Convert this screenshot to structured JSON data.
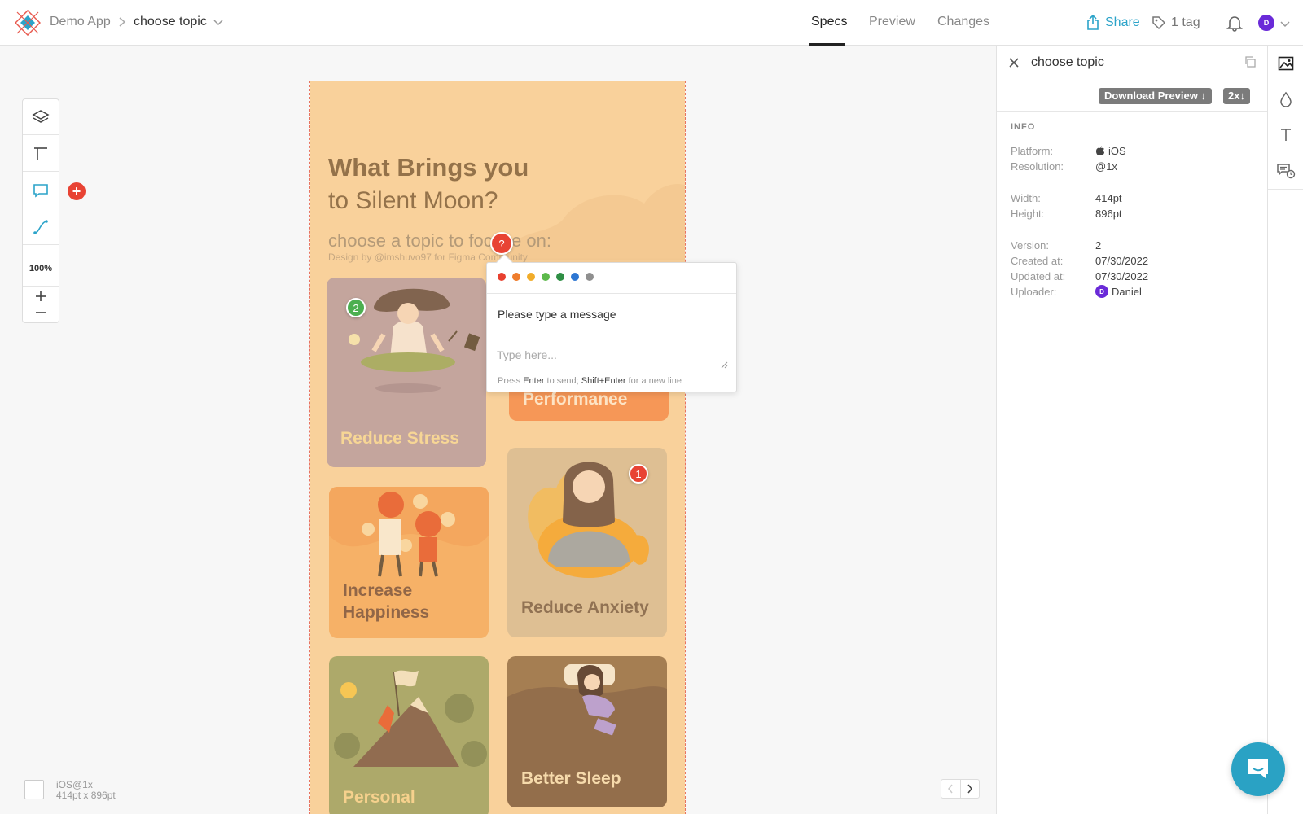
{
  "header": {
    "project": "Demo App",
    "screen": "choose topic",
    "tabs": [
      "Specs",
      "Preview",
      "Changes"
    ],
    "active_tab": "Specs",
    "share_label": "Share",
    "tag_label": "1 tag",
    "avatar_initial": "D"
  },
  "toolbar": {
    "zoom": "100%"
  },
  "artboard": {
    "title_line1": "What Brings you",
    "title_line2": "to Silent Moon?",
    "subtitle": "choose a topic to focuse on:",
    "credit": "Design by @imshuvo97 for Figma Community",
    "cards": [
      {
        "label": "Reduce Stress",
        "color": "#c1a097",
        "label_color": "#f7d48f"
      },
      {
        "label": "Performanee",
        "color": "#f6914d",
        "label_color": "#fde3c2"
      },
      {
        "label_line1": "Increase",
        "label_line2": "Happiness",
        "color": "#f6ad5e",
        "label_color": "#8b5d3c"
      },
      {
        "label": "Reduce Anxiety",
        "color": "#dcbc8d",
        "label_color": "#8b6a49"
      },
      {
        "label": "Personal",
        "color": "#a8a461",
        "label_color": "#f6cf86"
      },
      {
        "label": "Better Sleep",
        "color": "#a07648",
        "label_color": "#f6d8a6"
      }
    ]
  },
  "pins": {
    "active": "?",
    "green": "2",
    "red": "1"
  },
  "comment_popup": {
    "colors": [
      "#e8402f",
      "#ef7d2d",
      "#f1ac2a",
      "#5cb94b",
      "#2f8f45",
      "#2d76d2",
      "#8f8f8f"
    ],
    "message": "Please type a message",
    "placeholder": "Type here...",
    "hint_press": "Press",
    "hint_enter": "Enter",
    "hint_send": "to send;",
    "hint_shift": "Shift+Enter",
    "hint_newline": "for a new line"
  },
  "device": {
    "name": "iOS@1x",
    "size": "414pt x 896pt"
  },
  "panel": {
    "title": "choose topic",
    "download_label": "Download Preview ↓",
    "scale_label": "2x↓",
    "info_heading": "INFO",
    "info": {
      "platform_key": "Platform:",
      "platform_val": "iOS",
      "resolution_key": "Resolution:",
      "resolution_val": "@1x",
      "width_key": "Width:",
      "width_val": "414pt",
      "height_key": "Height:",
      "height_val": "896pt",
      "version_key": "Version:",
      "version_val": "2",
      "created_key": "Created at:",
      "created_val": "07/30/2022",
      "updated_key": "Updated at:",
      "updated_val": "07/30/2022",
      "uploader_key": "Uploader:",
      "uploader_val": "Daniel"
    }
  },
  "colors": {
    "accent": "#2ba3c9",
    "pin_red": "#e84334",
    "pin_green": "#4caf50",
    "avatar": "#6a2ad8"
  }
}
